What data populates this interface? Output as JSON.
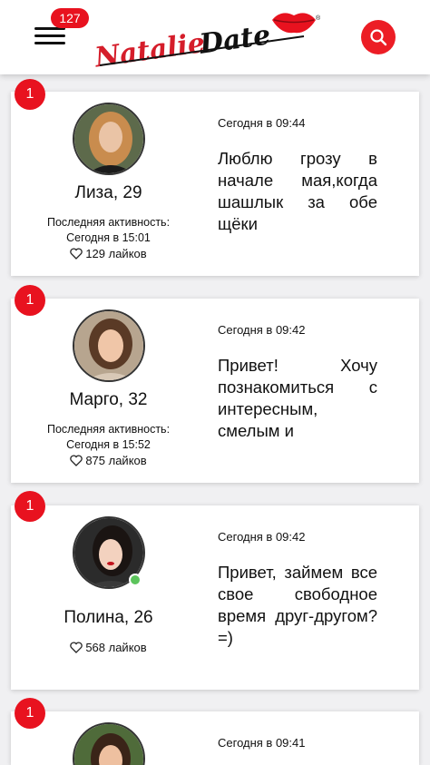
{
  "header": {
    "menu_badge": "127",
    "logo_text": "NatalieDate",
    "logo_icon": "lips-icon",
    "menu_icon": "hamburger-icon",
    "search_icon": "search-icon",
    "accent_color": "#e8121f"
  },
  "cards": [
    {
      "badge": "1",
      "name": "Лиза, 29",
      "activity_label": "Последняя активность:",
      "activity_time": "Сегодня в 15:01",
      "likes": "129 лайков",
      "time": "Сегодня в 09:44",
      "message": "Люблю грозу в начале мая,когда шашлык за обе щёки"
    },
    {
      "badge": "1",
      "name": "Марго, 32",
      "activity_label": "Последняя активность:",
      "activity_time": "Сегодня в 15:52",
      "likes": "875 лайков",
      "time": "Сегодня в 09:42",
      "message": "Привет! Хочу познакомиться с интересным, смелым и"
    },
    {
      "badge": "1",
      "name": "Полина, 26",
      "online": true,
      "likes": "568 лайков",
      "time": "Сегодня в 09:42",
      "message": "Привет, займем все свое свободное время друг-другом? =)"
    },
    {
      "badge": "1",
      "time": "Сегодня в 09:41"
    }
  ]
}
